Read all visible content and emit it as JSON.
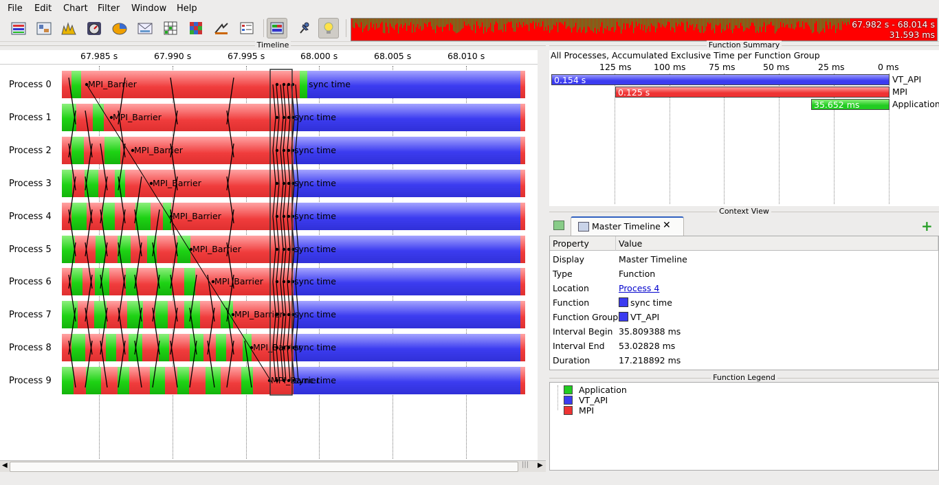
{
  "menu": [
    "File",
    "Edit",
    "Chart",
    "Filter",
    "Window",
    "Help"
  ],
  "toolbar": {
    "icons": [
      "master-timeline-icon",
      "process-timeline-icon",
      "counter-timeline-icon",
      "summary-timeline-icon",
      "function-summary-icon",
      "message-summary-icon",
      "communication-matrix-icon",
      "io-activity-icon",
      "call-tree-icon",
      "function-legend-icon",
      "zoom-mode-icon",
      "pin-icon",
      "info-bulb-icon"
    ],
    "zoom_range": "67.982 s - 68.014 s",
    "zoom_duration": "31.593 ms"
  },
  "colors": {
    "application": "#22cc22",
    "vt_api": "#3c3cf0",
    "mpi": "#ee3333",
    "link": "#0000cc"
  },
  "timeline": {
    "title": "Timeline",
    "ticks": [
      "67.985 s",
      "67.990 s",
      "67.995 s",
      "68.000 s",
      "68.005 s",
      "68.010 s"
    ],
    "processes": [
      "Process 0",
      "Process 1",
      "Process 2",
      "Process 3",
      "Process 4",
      "Process 5",
      "Process 6",
      "Process 7",
      "Process 8",
      "Process 9"
    ],
    "barrier_label": "MPI_Barrier",
    "sync_label": "sync time"
  },
  "function_summary": {
    "title": "Function Summary",
    "subtitle": "All Processes, Accumulated Exclusive Time per Function Group",
    "ticks": [
      "125 ms",
      "100 ms",
      "75 ms",
      "50 ms",
      "25 ms",
      "0 ms"
    ],
    "bars": [
      {
        "name": "VT_API",
        "value": "0.154 s",
        "ms": 154,
        "color": "#3c3cf0"
      },
      {
        "name": "MPI",
        "value": "0.125 s",
        "ms": 125,
        "color": "#ee3333"
      },
      {
        "name": "Application",
        "value": "35.652 ms",
        "ms": 35.652,
        "color": "#22cc22"
      }
    ]
  },
  "context_view": {
    "title": "Context View",
    "tab": "Master Timeline",
    "headers": [
      "Property",
      "Value"
    ],
    "rows": [
      {
        "property": "Display",
        "value": "Master Timeline"
      },
      {
        "property": "Type",
        "value": "Function"
      },
      {
        "property": "Location",
        "value": "Process 4"
      },
      {
        "property": "Function",
        "value": "sync time"
      },
      {
        "property": "Function Group",
        "value": "VT_API"
      },
      {
        "property": "Interval Begin",
        "value": "35.809388 ms"
      },
      {
        "property": "Interval End",
        "value": "53.02828 ms"
      },
      {
        "property": "Duration",
        "value": "17.218892 ms"
      }
    ]
  },
  "function_legend": {
    "title": "Function Legend",
    "items": [
      {
        "name": "Application",
        "color": "#22cc22"
      },
      {
        "name": "VT_API",
        "color": "#3c3cf0"
      },
      {
        "name": "MPI",
        "color": "#ee3333"
      }
    ]
  }
}
